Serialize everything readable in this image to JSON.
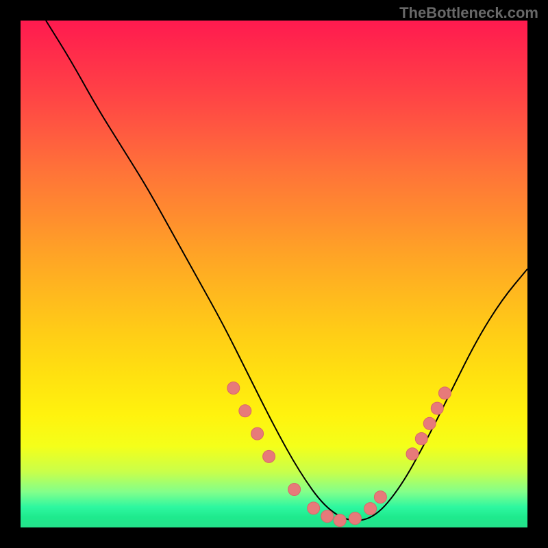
{
  "watermark": "TheBottleneck.com",
  "chart_data": {
    "type": "line",
    "title": "",
    "xlabel": "",
    "ylabel": "",
    "xlim": [
      0,
      100
    ],
    "ylim": [
      0,
      100
    ],
    "grid": false,
    "series": [
      {
        "name": "curve",
        "x_pct": [
          5,
          10,
          15,
          20,
          25,
          30,
          35,
          40,
          45,
          50,
          55,
          60,
          65,
          70,
          75,
          80,
          85,
          90,
          95,
          100
        ],
        "y_pct": [
          100,
          92,
          83,
          75,
          67,
          58,
          49,
          40,
          30,
          20,
          11,
          4,
          1,
          2,
          8,
          17,
          27,
          37,
          45,
          51
        ]
      }
    ],
    "annotations": {
      "markers_x_pct": [
        42.0,
        44.3,
        46.7,
        49.0,
        54.0,
        57.8,
        60.5,
        63.0,
        66.0,
        69.0,
        71.0,
        77.3,
        79.1,
        80.7,
        82.2,
        83.7
      ],
      "markers_y_pct": [
        27.5,
        23.0,
        18.5,
        14.0,
        7.5,
        3.8,
        2.2,
        1.4,
        1.8,
        3.7,
        6.0,
        14.5,
        17.5,
        20.5,
        23.5,
        26.5
      ]
    },
    "gradient_stops": [
      {
        "pct": 0,
        "color": "#ff1a4f"
      },
      {
        "pct": 14,
        "color": "#ff4146"
      },
      {
        "pct": 30,
        "color": "#ff7438"
      },
      {
        "pct": 46,
        "color": "#ffa326"
      },
      {
        "pct": 62,
        "color": "#ffce16"
      },
      {
        "pct": 78,
        "color": "#fff30e"
      },
      {
        "pct": 89,
        "color": "#c9ff4a"
      },
      {
        "pct": 96,
        "color": "#2df7a0"
      },
      {
        "pct": 100,
        "color": "#24e28b"
      }
    ],
    "colors": {
      "curve": "#000000",
      "marker_fill": "#e77a7a",
      "marker_stroke": "#d96868",
      "watermark": "#686868",
      "background": "#000000"
    }
  }
}
